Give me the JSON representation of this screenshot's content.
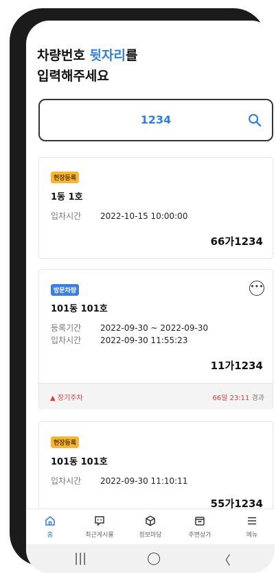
{
  "heading": {
    "line1_prefix": "차량번호 ",
    "line1_highlight": "뒷자리",
    "line1_suffix": "를",
    "line2": "입력해주세요"
  },
  "search": {
    "value": "1234",
    "icon": "search-icon"
  },
  "cards": [
    {
      "badge": "현장등록",
      "unit": "1동 1호",
      "rows": [
        {
          "label": "입차시간",
          "value": "2022-10-15 10:00:00"
        }
      ],
      "plate": "66가1234"
    },
    {
      "badge": "방문차량",
      "unit": "101동 101호",
      "rows": [
        {
          "label": "등록기간",
          "value": "2022-09-30 ~ 2022-09-30"
        },
        {
          "label": "입차시간",
          "value": "2022-09-30 11:55:23"
        }
      ],
      "plate": "11가1234",
      "warning": {
        "label": "장기주차",
        "duration": "66일 23:11",
        "suffix": "경과"
      }
    },
    {
      "badge": "현장등록",
      "unit": "101동 101호",
      "rows": [
        {
          "label": "입차시간",
          "value": "2022-09-30 11:10:11"
        }
      ],
      "plate": "55가1234"
    }
  ],
  "tabs": [
    {
      "label": "홈",
      "icon": "home-icon"
    },
    {
      "label": "최근게시물",
      "icon": "chat-icon"
    },
    {
      "label": "정보마당",
      "icon": "cube-icon"
    },
    {
      "label": "주변상가",
      "icon": "bag-icon"
    },
    {
      "label": "메뉴",
      "icon": "menu-icon"
    }
  ],
  "navbar": {
    "recent": "|||",
    "home": "◯",
    "back": "〈"
  },
  "colors": {
    "accent": "#2f7fe0",
    "badge_orange": "#f6b633",
    "badge_blue": "#3a7fe0",
    "warning": "#e53935"
  }
}
